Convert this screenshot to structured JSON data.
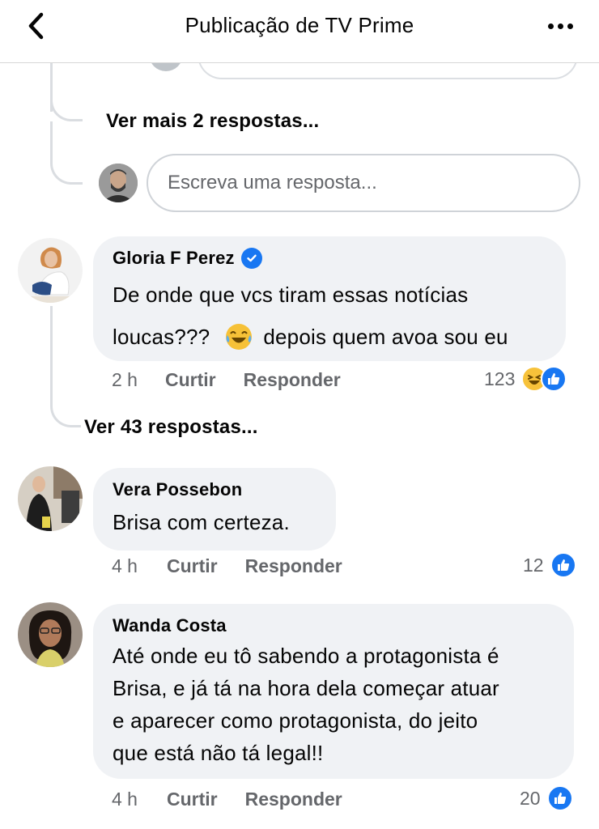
{
  "header": {
    "title": "Publicação de TV Prime",
    "back_icon": "chevron-left-icon",
    "more_icon": "more-horizontal-icon"
  },
  "thread": {
    "more_replies_label": "Ver mais 2 respostas...",
    "reply_placeholder": "Escreva uma resposta..."
  },
  "comments": [
    {
      "author": "Gloria F Perez",
      "verified": true,
      "text_line1": "De onde que vcs tiram essas notícias",
      "text_line2a": "loucas???",
      "text_line2b": "depois quem avoa sou eu",
      "time": "2 h",
      "like_label": "Curtir",
      "reply_label": "Responder",
      "reaction_count": "123",
      "reactions": [
        "haha",
        "like"
      ],
      "replies_label": "Ver 43 respostas..."
    },
    {
      "author": "Vera Possebon",
      "text": "Brisa com certeza.",
      "time": "4 h",
      "like_label": "Curtir",
      "reply_label": "Responder",
      "reaction_count": "12",
      "reactions": [
        "like"
      ]
    },
    {
      "author": "Wanda Costa",
      "lines": [
        "Até onde eu tô sabendo a protagonista é",
        "Brisa, e já tá na hora dela começar atuar",
        "e aparecer como protagonista, do jeito",
        "que está não tá legal!!"
      ],
      "time": "4 h",
      "like_label": "Curtir",
      "reply_label": "Responder",
      "reaction_count": "20",
      "reactions": [
        "like"
      ]
    }
  ],
  "colors": {
    "accent": "#1877f2",
    "bubble": "#f0f2f5",
    "secondary_text": "#65676b",
    "thread_line": "#dadde1"
  }
}
